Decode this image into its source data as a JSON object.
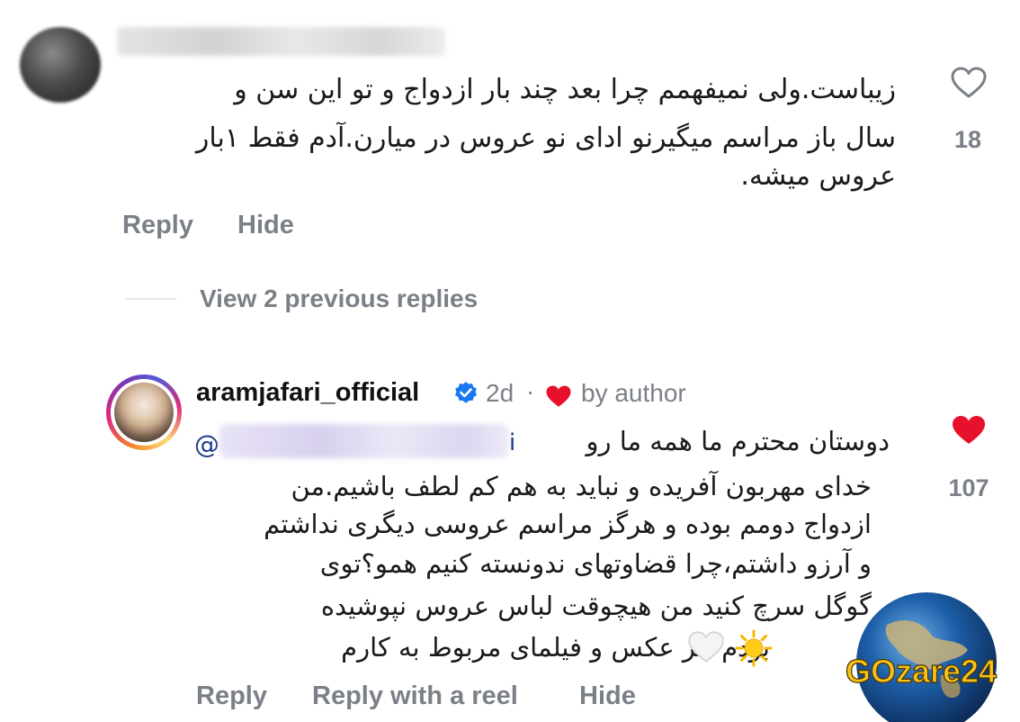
{
  "comment_1": {
    "lines": [
      "زیباست.ولی نمیفهمم چرا بعد چند بار ازدواج و تو این سن و",
      "سال باز مراسم میگیرنو ادای نو عروس در میارن.آدم فقط ۱بار",
      "عروس میشه."
    ],
    "like_count": "18",
    "actions": {
      "reply": "Reply",
      "hide": "Hide"
    }
  },
  "view_replies": "View 2 previous replies",
  "reply": {
    "username": "aramjafari_official",
    "time": "2d",
    "separator": "·",
    "liked_by": "by author",
    "mention_prefix": "@",
    "lines": [
      "دوستان محترم ما همه ما رو",
      "خدای مهربون آفریده و نباید به هم کم لطف باشیم.من",
      "ازدواج دومم بوده و هرگز مراسم عروسی دیگری نداشتم",
      "و آرزو داشتم،چرا قضاوتهای ندونسته کنیم همو؟توی",
      "گوگل سرچ کنید من هیچوقت لباس عروس نپوشیده",
      "بودم جز عکس و فیلمای مربوط به کارم"
    ],
    "like_count": "107",
    "actions": {
      "reply": "Reply",
      "reply_with_reel": "Reply with a reel",
      "hide": "Hide"
    }
  },
  "watermark_text": "GOzare24",
  "colors": {
    "liked_heart": "#e8112d",
    "muted_text": "#7b8088",
    "verified_blue": "#1877f2"
  }
}
